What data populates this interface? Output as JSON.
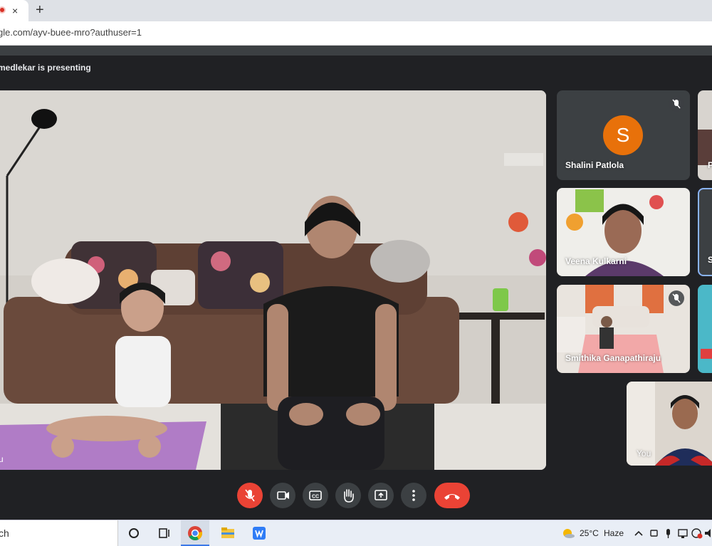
{
  "browser": {
    "url": "gle.com/ayv-buee-mro?authuser=1",
    "tab_close": "×",
    "new_tab": "+"
  },
  "meet": {
    "presenting_text": "medlekar is presenting",
    "main_participant_label": "u",
    "participants": [
      {
        "name": "Shalini Patlola",
        "avatar_letter": "S",
        "muted": true
      },
      {
        "name": "Veena Kulkarni",
        "muted": false
      },
      {
        "name": "Smithika Ganapathiraju",
        "muted": true
      },
      {
        "name": "You",
        "muted": false
      }
    ],
    "edge_labels": [
      "P",
      "S"
    ],
    "controls": [
      "mic-off",
      "camera",
      "captions",
      "raise-hand",
      "present",
      "more",
      "hang-up"
    ]
  },
  "taskbar": {
    "search_text": "ch",
    "temperature": "25°C",
    "weather": "Haze"
  },
  "colors": {
    "meet_bg": "#202124",
    "tile_bg": "#3c4043",
    "red": "#ea4335",
    "avatar_orange": "#e8710a"
  }
}
